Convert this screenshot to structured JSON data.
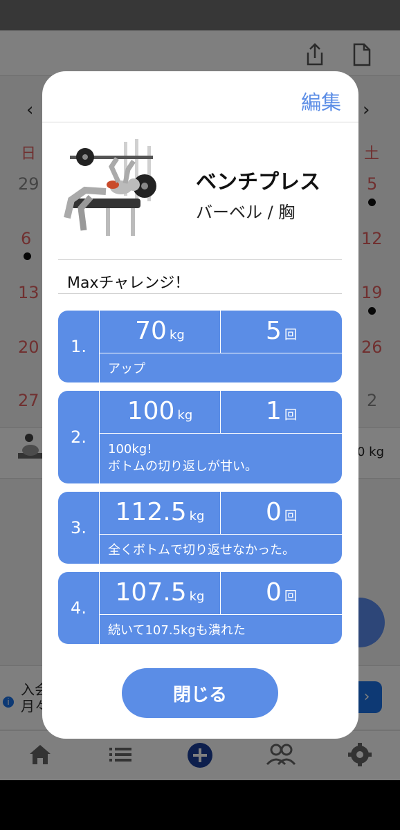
{
  "background": {
    "calendar": {
      "weekday_sun": "日",
      "weekday_sat": "土",
      "left_days": [
        "29",
        "6",
        "13",
        "20",
        "27"
      ],
      "right_days": [
        "5",
        "12",
        "19",
        "26",
        "2"
      ],
      "nav_prev": "‹",
      "nav_next": "›"
    },
    "log_row_value": "0 kg",
    "ad": {
      "text": "入会\n月々",
      "button": "›",
      "info": "i"
    },
    "nav_icons": [
      "home-icon",
      "list-icon",
      "add-icon",
      "friends-icon",
      "settings-icon"
    ]
  },
  "modal": {
    "edit_label": "編集",
    "exercise": {
      "name": "ベンチプレス",
      "category": "バーベル / 胸"
    },
    "memo": "Maxチャレンジ！",
    "sets": [
      {
        "index": "1.",
        "weight": "70",
        "weight_unit": "kg",
        "reps": "5",
        "reps_unit": "回",
        "note": "アップ"
      },
      {
        "index": "2.",
        "weight": "100",
        "weight_unit": "kg",
        "reps": "1",
        "reps_unit": "回",
        "note": "100kg!\nボトムの切り返しが甘い。"
      },
      {
        "index": "3.",
        "weight": "112.5",
        "weight_unit": "kg",
        "reps": "0",
        "reps_unit": "回",
        "note": "全くボトムで切り返せなかった。"
      },
      {
        "index": "4.",
        "weight": "107.5",
        "weight_unit": "kg",
        "reps": "0",
        "reps_unit": "回",
        "note": "続いて107.5kgも潰れた"
      }
    ],
    "close_label": "閉じる"
  },
  "colors": {
    "accent": "#5b8de6",
    "calendar_holiday": "#e06060",
    "scrim": "rgba(0,0,0,0.5)"
  }
}
